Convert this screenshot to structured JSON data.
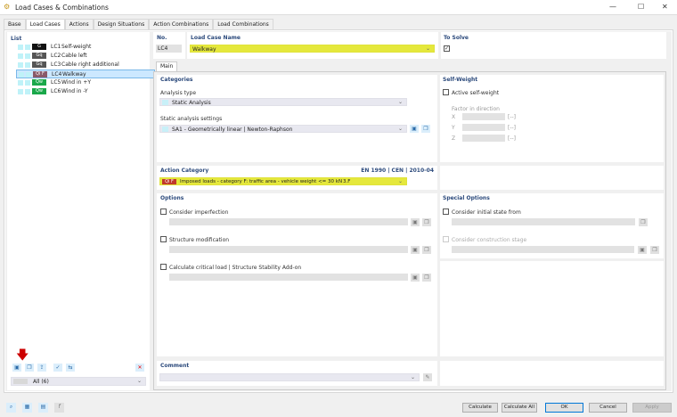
{
  "window": {
    "title": "Load Cases & Combinations",
    "minimize": "—",
    "maximize": "☐",
    "close": "✕"
  },
  "tabs": [
    "Base",
    "Load Cases",
    "Actions",
    "Design Situations",
    "Action Combinations",
    "Load Combinations"
  ],
  "list": {
    "header": "List",
    "items": [
      {
        "badge": "G",
        "badge_color": "#111111",
        "no": "LC1",
        "name": "Self-weight"
      },
      {
        "badge": "Gq",
        "badge_color": "#555555",
        "no": "LC2",
        "name": "Cable left"
      },
      {
        "badge": "Gq",
        "badge_color": "#555555",
        "no": "LC3",
        "name": "Cable right additional"
      },
      {
        "badge": "Qi F",
        "badge_color": "#8a5a6a",
        "no": "LC4",
        "name": "Walkway",
        "selected": true
      },
      {
        "badge": "Qw",
        "badge_color": "#1aa84a",
        "no": "LC5",
        "name": "Wind in +Y"
      },
      {
        "badge": "Qw",
        "badge_color": "#1aa84a",
        "no": "LC6",
        "name": "Wind in -Y"
      }
    ],
    "filter": "All (6)"
  },
  "no": {
    "label": "No.",
    "value": "LC4"
  },
  "name": {
    "label": "Load Case Name",
    "value": "Walkway"
  },
  "to_solve": {
    "label": "To Solve",
    "checked": true
  },
  "main_tab": "Main",
  "categories": {
    "header": "Categories",
    "analysis_type_label": "Analysis type",
    "analysis_type": "Static Analysis",
    "settings_label": "Static analysis settings",
    "settings": "SA1 - Geometrically linear | Newton-Raphson"
  },
  "self_weight": {
    "header": "Self-Weight",
    "active_label": "Active self-weight",
    "factor_label": "Factor in direction",
    "axes": [
      "X",
      "Y",
      "Z"
    ],
    "unit": "[--]"
  },
  "action_category": {
    "header": "Action Category",
    "standard": "EN 1990 | CEN | 2010-04",
    "badge": "Qi F",
    "badge_color": "#c0392b",
    "value": "Imposed loads - category F: traffic area - vehicle weight <= 30 kN",
    "code": "3.F"
  },
  "options": {
    "header": "Options",
    "items": [
      "Consider imperfection",
      "Structure modification",
      "Calculate critical load | Structure Stability Add-on"
    ]
  },
  "special_options": {
    "header": "Special Options",
    "initial_state": "Consider initial state from",
    "construction_stage": "Consider construction stage"
  },
  "comment": {
    "header": "Comment"
  },
  "buttons": {
    "calculate": "Calculate",
    "calculate_all": "Calculate All",
    "ok": "OK",
    "cancel": "Cancel",
    "apply": "Apply"
  },
  "colors": {
    "highlight": "#e5e83c",
    "accent_border": "#0078d7",
    "header_text": "#2c4a7c"
  }
}
